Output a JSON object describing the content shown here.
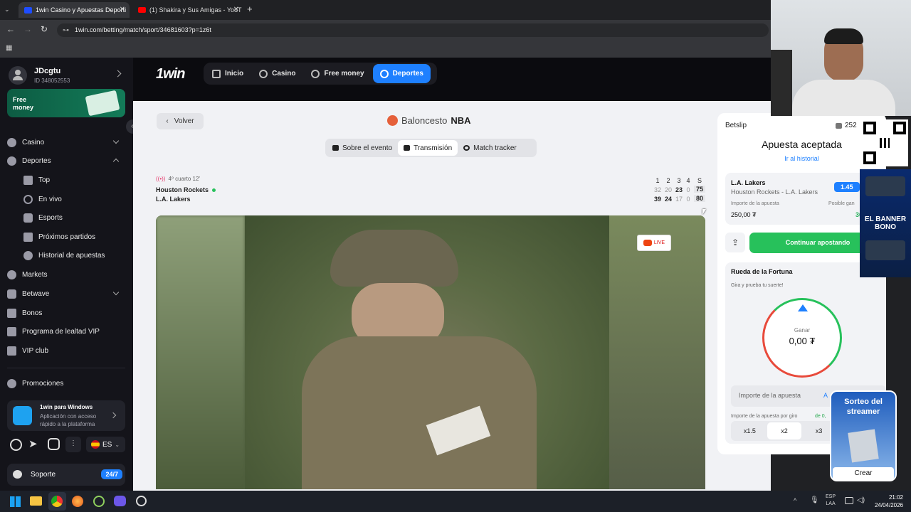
{
  "browser": {
    "tabs": [
      {
        "title": "1win Casino y Apuestas Deporti"
      },
      {
        "title": "(1) Shakira y Sus Amigas - YouT"
      }
    ],
    "url": "1win.com/betting/match/sport/34681603?p=1z6t"
  },
  "sidebar": {
    "user_name": "JDcgtu",
    "user_id": "ID 348052553",
    "promo_banner": "Free money",
    "items": [
      {
        "label": "Casino"
      },
      {
        "label": "Deportes"
      },
      {
        "label": "Top"
      },
      {
        "label": "En vivo"
      },
      {
        "label": "Esports"
      },
      {
        "label": "Próximos partidos"
      },
      {
        "label": "Historial de apuestas"
      },
      {
        "label": "Markets"
      },
      {
        "label": "Betwave"
      },
      {
        "label": "Bonos"
      },
      {
        "label": "Programa de lealtad VIP"
      },
      {
        "label": "VIP club"
      },
      {
        "label": "Promociones"
      }
    ],
    "app_title": "1win para Windows",
    "app_desc": "Aplicación con acceso rápido a la plataforma",
    "lang": "ES",
    "support": "Soporte",
    "support_badge": "24/7"
  },
  "header": {
    "logo": "1win",
    "nav": [
      {
        "label": "Inicio"
      },
      {
        "label": "Casino"
      },
      {
        "label": "Free money"
      },
      {
        "label": "Deportes"
      }
    ]
  },
  "match": {
    "back": "Volver",
    "sport": "Baloncesto",
    "league": "NBA",
    "tabs": [
      {
        "label": "Sobre el evento"
      },
      {
        "label": "Transmisión"
      },
      {
        "label": "Match tracker"
      }
    ],
    "status": "4º cuarto 12'",
    "periods": [
      "1",
      "2",
      "3",
      "4",
      "S"
    ],
    "teams": [
      {
        "name": "Houston Rockets",
        "scores": [
          "32",
          "20",
          "23",
          "0",
          "75"
        ]
      },
      {
        "name": "L.A. Lakers",
        "scores": [
          "39",
          "24",
          "17",
          "0",
          "80"
        ]
      }
    ],
    "live_badge": "LIVE"
  },
  "betslip": {
    "title": "Betslip",
    "balance": "252",
    "accepted": "Apuesta aceptada",
    "history_link": "Ir al historial",
    "bet_team": "L.A. Lakers",
    "bet_match": "Houston Rockets - L.A. Lakers",
    "odds": "1.45",
    "stake_label": "Importe de la apuesta",
    "stake_value": "250,00 ₮",
    "win_label": "Posible gan",
    "win_value": "362,",
    "continue": "Continuar apostando",
    "wheel_title": "Rueda de la Fortuna",
    "wheel_sub": "Gira y prueba tu suerte!",
    "wheel_win_label": "Ganar",
    "wheel_win_value": "0,00 ₮",
    "amount_placeholder": "Importe de la apuesta",
    "amount_suffix": "A",
    "per_spin": "Importe de la apuesta por giro",
    "per_spin_value": "de 0,",
    "multipliers": [
      {
        "label": "x1.5"
      },
      {
        "label": "x2"
      },
      {
        "label": "x3"
      }
    ]
  },
  "overlay": {
    "banner_title": "EL BANNER BONO",
    "sorteo": "Sorteo del streamer",
    "crear": "Crear"
  },
  "taskbar": {
    "lang1": "ESP",
    "lang2": "LAA",
    "time": "21:02",
    "date": "24/04/2026"
  }
}
